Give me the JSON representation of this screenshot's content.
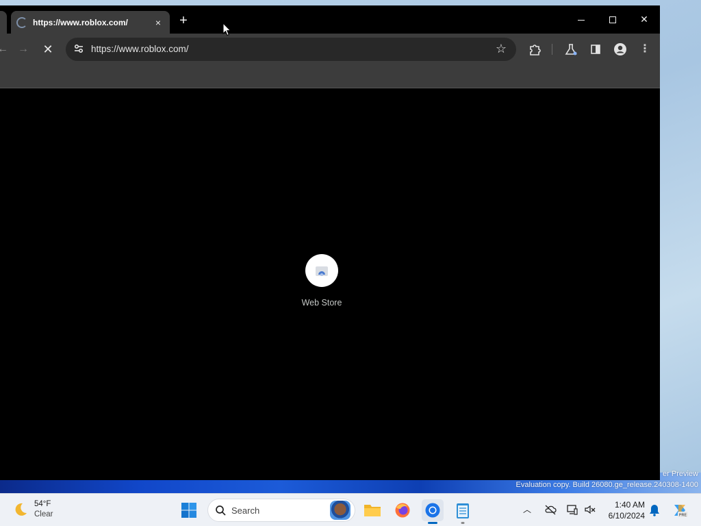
{
  "browser": {
    "tab": {
      "title": "https://www.roblox.com/",
      "close_glyph": "×"
    },
    "new_tab_glyph": "+",
    "window_controls": {
      "minimize": "minimize-icon",
      "maximize": "maximize-icon",
      "close_glyph": "✕"
    },
    "toolbar": {
      "back_glyph": "←",
      "forward_glyph": "→",
      "stop_glyph": "✕",
      "url": "https://www.roblox.com/",
      "star_glyph": "☆",
      "menu_glyph": "⋮"
    },
    "content": {
      "shortcut_label": "Web Store"
    }
  },
  "watermark": {
    "line1": "er Preview",
    "line2": "Evaluation copy. Build 26080.ge_release.240308-1400"
  },
  "taskbar": {
    "weather": {
      "temp": "54°F",
      "condition": "Clear"
    },
    "search_placeholder": "Search",
    "apps": [
      "file-explorer",
      "firefox",
      "chrome",
      "notepad"
    ],
    "clock": {
      "time": "1:40 AM",
      "date": "6/10/2024"
    }
  },
  "colors": {
    "browser_frame": "#000000",
    "toolbar": "#3c3c3c",
    "omnibox": "#282828",
    "taskbar": "#eef1f6",
    "accent": "#0067c0"
  }
}
